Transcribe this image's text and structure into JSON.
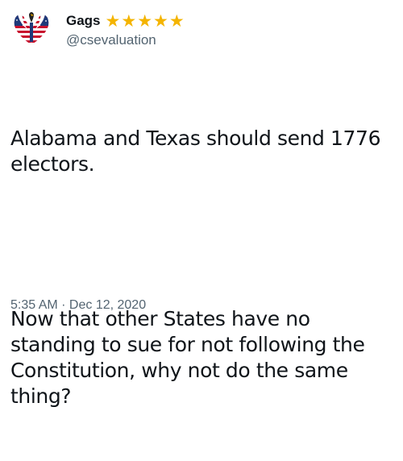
{
  "tweet": {
    "author": {
      "display_name": "Gags",
      "handle": "@csevaluation",
      "avatar_icon": "eagle-flag-icon",
      "star_color": "#f4b400",
      "star_count": 5,
      "star_glyph": "★"
    },
    "text": {
      "paragraph_1": "Alabama and Texas should send 1776\nelectors.",
      "paragraph_2": "Now that other States have no\nstanding to sue for not following the\nConstitution, why not do the same\nthing?"
    },
    "timestamp": "5:35 AM · Dec 12, 2020"
  }
}
